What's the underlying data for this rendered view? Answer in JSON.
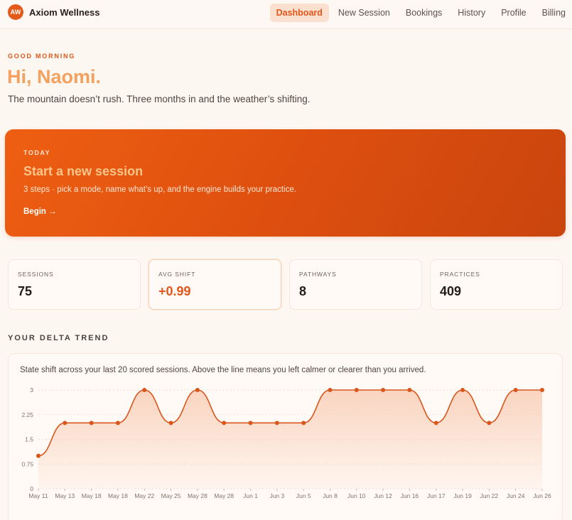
{
  "brand": {
    "logo_text": "AW",
    "name": "Axiom Wellness"
  },
  "nav": [
    {
      "label": "Dashboard",
      "active": true
    },
    {
      "label": "New Session",
      "active": false
    },
    {
      "label": "Bookings",
      "active": false
    },
    {
      "label": "History",
      "active": false
    },
    {
      "label": "Profile",
      "active": false
    },
    {
      "label": "Billing",
      "active": false
    }
  ],
  "greeting": {
    "eyebrow": "GOOD MORNING",
    "title": "Hi, Naomi.",
    "tagline": "The mountain doesn’t rush. Three months in and the weather’s shifting."
  },
  "hero": {
    "eyebrow": "TODAY",
    "title": "Start a new session",
    "subtitle": "3 steps · pick a mode, name what’s up, and the engine builds your practice.",
    "cta": "Begin →"
  },
  "stats": [
    {
      "label": "SESSIONS",
      "value": "75"
    },
    {
      "label": "AVG SHIFT",
      "value": "+0.99"
    },
    {
      "label": "PATHWAYS",
      "value": "8"
    },
    {
      "label": "PRACTICES",
      "value": "409"
    }
  ],
  "trend": {
    "title": "YOUR DELTA TREND",
    "description": "State shift across your last 20 scored sessions. Above the line means you left calmer or clearer than you arrived."
  },
  "colors": {
    "accent": "#e2561a",
    "line": "#d9561c",
    "fill": "#f9d2bd",
    "background": "#fdf7f1"
  },
  "chart_data": {
    "type": "area",
    "x": [
      "May 11",
      "May 13",
      "May 18",
      "May 18",
      "May 22",
      "May 25",
      "May 28",
      "May 28",
      "Jun 1",
      "Jun 3",
      "Jun 5",
      "Jun 8",
      "Jun 10",
      "Jun 12",
      "Jun 16",
      "Jun 17",
      "Jun 19",
      "Jun 22",
      "Jun 24",
      "Jun 26"
    ],
    "values": [
      1,
      2,
      2,
      2,
      3,
      2,
      3,
      2,
      2,
      2,
      2,
      3,
      3,
      3,
      3,
      2,
      3,
      2,
      3,
      3
    ],
    "yticks": [
      "0",
      "0.75",
      "1.5",
      "2.25",
      "3"
    ],
    "ylim": [
      0,
      3
    ],
    "grid": true,
    "smooth": true
  }
}
